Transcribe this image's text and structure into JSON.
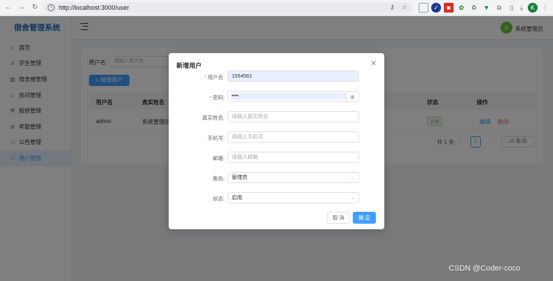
{
  "browser": {
    "url": "http://localhost:3000/user",
    "profile_initial": "K"
  },
  "app": {
    "title": "宿舍管理系统",
    "admin_name": "系统管理员"
  },
  "sidebar": {
    "items": [
      {
        "label": "首页",
        "icon": "home-icon"
      },
      {
        "label": "学生管理",
        "icon": "user-icon"
      },
      {
        "label": "宿舍楼管理",
        "icon": "building-icon"
      },
      {
        "label": "房间管理",
        "icon": "house-icon"
      },
      {
        "label": "报修管理",
        "icon": "tool-icon"
      },
      {
        "label": "考勤管理",
        "icon": "check-circle-icon"
      },
      {
        "label": "公告管理",
        "icon": "megaphone-icon"
      },
      {
        "label": "用户管理",
        "icon": "users-icon"
      }
    ],
    "active_index": 7
  },
  "search": {
    "label": "用户名:",
    "placeholder": "请输入用户名"
  },
  "toolbar": {
    "add_label": "+ 新增用户"
  },
  "table": {
    "headers": {
      "username": "用户名",
      "realname": "真实姓名",
      "status": "状态",
      "actions": "操作"
    },
    "rows": [
      {
        "username": "admin",
        "realname": "系统管理员",
        "status": "启用",
        "edit": "编辑",
        "delete": "删除"
      }
    ]
  },
  "pagination": {
    "total": "共 1 条",
    "current": "1",
    "page_size": "10 条/页"
  },
  "dialog": {
    "title": "新增用户",
    "fields": {
      "username": {
        "label": "用户名:",
        "value": "1554561",
        "required": true
      },
      "password": {
        "label": "密码:",
        "value": "••••",
        "required": true
      },
      "realname": {
        "label": "真实姓名:",
        "placeholder": "请输入真实姓名"
      },
      "phone": {
        "label": "手机号:",
        "placeholder": "请输入手机号"
      },
      "email": {
        "label": "邮箱:",
        "placeholder": "请输入邮箱"
      },
      "role": {
        "label": "角色:",
        "value": "管理员"
      },
      "status": {
        "label": "状态:",
        "value": "启用"
      }
    },
    "cancel_label": "取 消",
    "confirm_label": "确 定"
  },
  "watermark": "CSDN @Coder-coco",
  "colors": {
    "primary": "#409eff",
    "danger": "#f56c6c",
    "success": "#67c23a",
    "logo": "#1f6fbf"
  }
}
